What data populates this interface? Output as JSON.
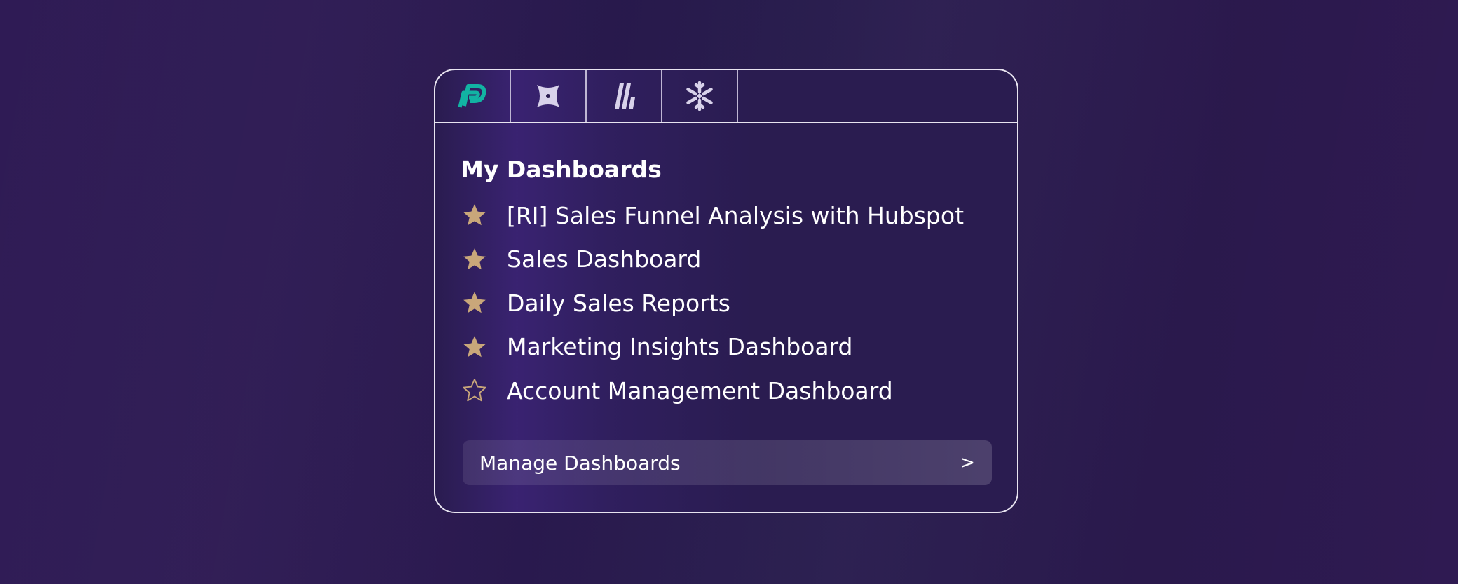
{
  "tabs": [
    {
      "icon": "preset-logo-icon",
      "color": "#12b3a3"
    },
    {
      "icon": "dbt-logo-icon",
      "color": "#d8d2ea"
    },
    {
      "icon": "stripes-logo-icon",
      "color": "#d8d2ea"
    },
    {
      "icon": "snowflake-icon",
      "color": "#d8d2ea"
    }
  ],
  "dashboards": {
    "heading": "My Dashboards",
    "items": [
      {
        "label": "[RI] Sales Funnel Analysis with Hubspot",
        "starred": true
      },
      {
        "label": "Sales Dashboard",
        "starred": true
      },
      {
        "label": "Daily Sales Reports",
        "starred": true
      },
      {
        "label": "Marketing Insights Dashboard",
        "starred": true
      },
      {
        "label": "Account Management Dashboard",
        "starred": false
      }
    ],
    "star_color": "#c9a77a"
  },
  "manage": {
    "label": "Manage Dashboards",
    "arrow": ">"
  }
}
